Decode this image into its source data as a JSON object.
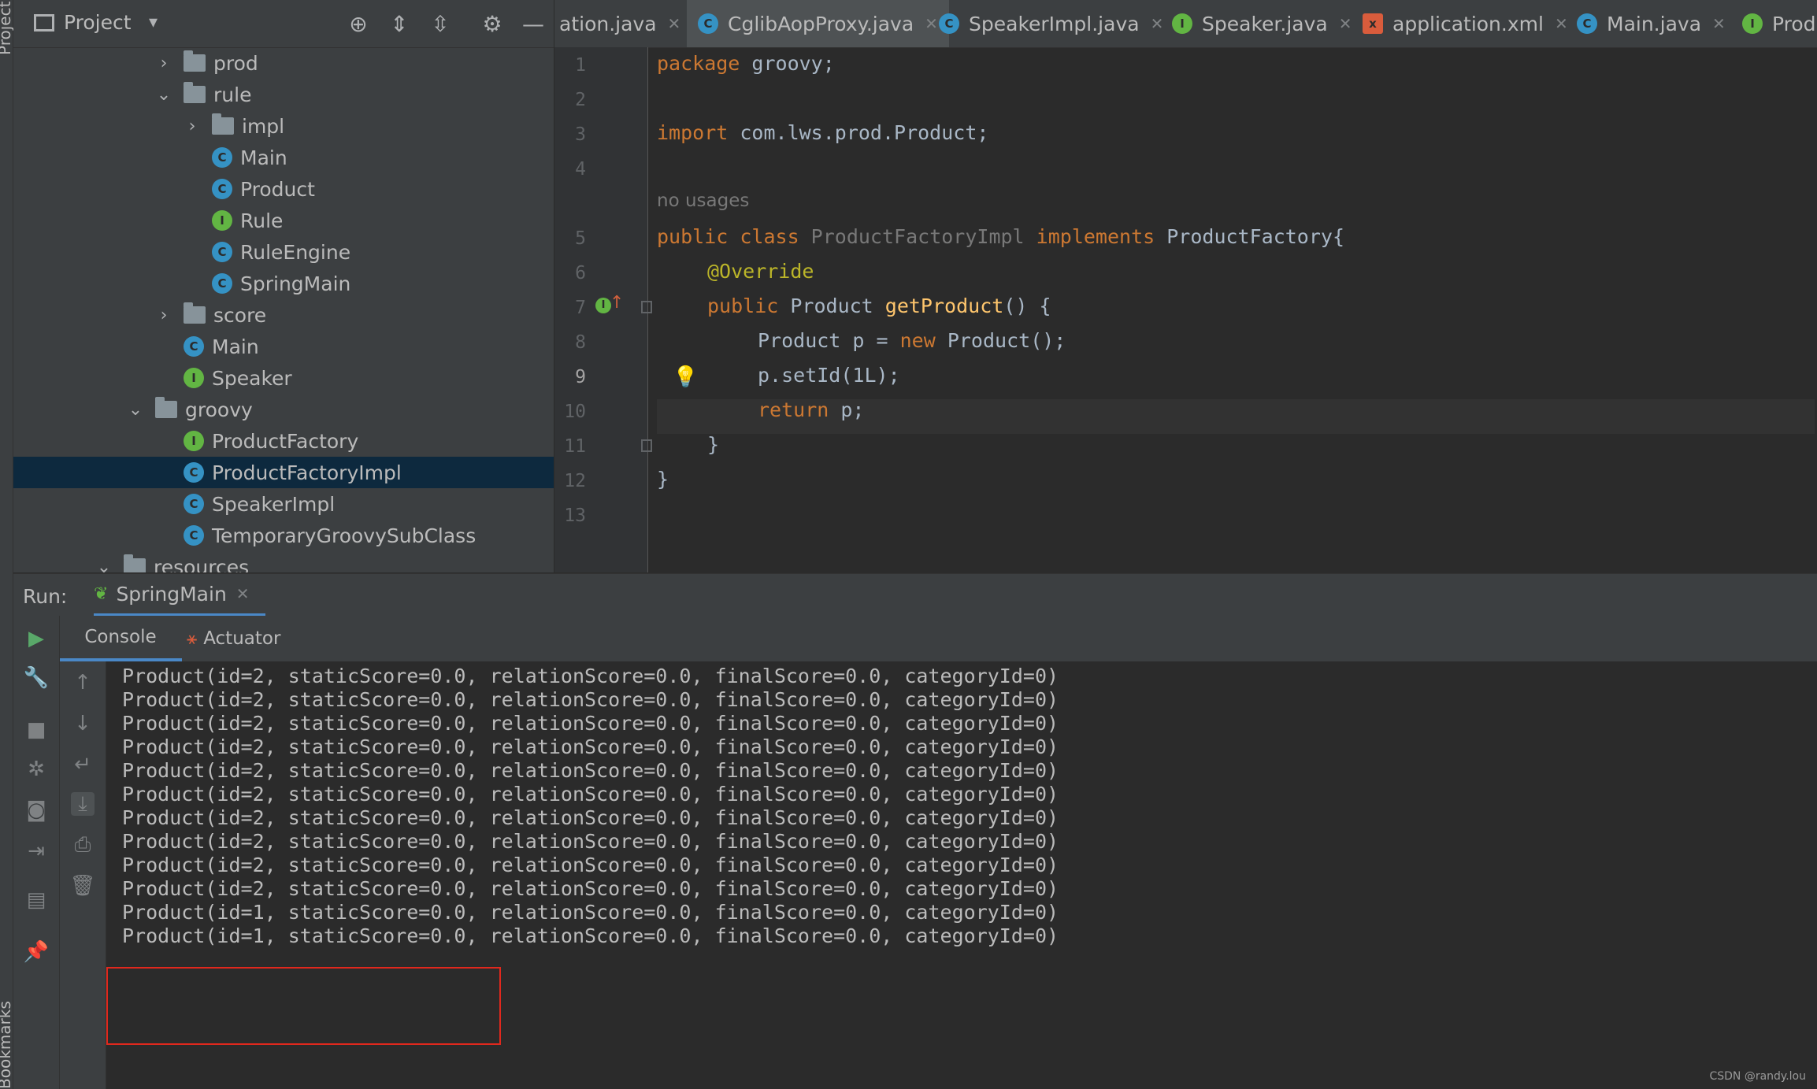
{
  "left_strip": {
    "project_label": "Project",
    "bookmarks_label": "Bookmarks"
  },
  "project_panel": {
    "title": "Project",
    "tree": [
      {
        "label": "prod",
        "type": "folder",
        "expand": "collapsed"
      },
      {
        "label": "rule",
        "type": "folder",
        "expand": "expanded"
      },
      {
        "label": "impl",
        "type": "package",
        "expand": "collapsed"
      },
      {
        "label": "Main",
        "type": "class"
      },
      {
        "label": "Product",
        "type": "class"
      },
      {
        "label": "Rule",
        "type": "interface"
      },
      {
        "label": "RuleEngine",
        "type": "class"
      },
      {
        "label": "SpringMain",
        "type": "class"
      },
      {
        "label": "score",
        "type": "folder",
        "expand": "collapsed"
      },
      {
        "label": "Main",
        "type": "class"
      },
      {
        "label": "Speaker",
        "type": "interface"
      },
      {
        "label": "groovy",
        "type": "folder",
        "expand": "expanded"
      },
      {
        "label": "ProductFactory",
        "type": "interface"
      },
      {
        "label": "ProductFactoryImpl",
        "type": "class",
        "selected": true
      },
      {
        "label": "SpeakerImpl",
        "type": "class"
      },
      {
        "label": "TemporaryGroovySubClass",
        "type": "class"
      },
      {
        "label": "resources",
        "type": "folder",
        "expand": "expanded"
      }
    ]
  },
  "editor": {
    "tabs": [
      {
        "label": "ation.java",
        "icon": "none"
      },
      {
        "label": "CglibAopProxy.java",
        "icon": "class"
      },
      {
        "label": "SpeakerImpl.java",
        "icon": "class"
      },
      {
        "label": "Speaker.java",
        "icon": "interface"
      },
      {
        "label": "application.xml",
        "icon": "xml"
      },
      {
        "label": "Main.java",
        "icon": "class"
      },
      {
        "label": "Prod",
        "icon": "interface"
      }
    ],
    "line_numbers": [
      "1",
      "2",
      "3",
      "4",
      "5",
      "6",
      "7",
      "8",
      "9",
      "10",
      "11",
      "12",
      "13"
    ],
    "usage_hint": "no usages",
    "code": {
      "l1_kw": "package",
      "l1_rest": " groovy;",
      "l3_kw": "import",
      "l3_rest": " com.lws.prod.Product;",
      "l5_kw1": "public",
      "l5_kw2": " class",
      "l5_name": " ProductFactoryImpl",
      "l5_kw3": " implements",
      "l5_rest": " ProductFactory{",
      "l6_ann": "@Override",
      "l7_kw": "public",
      "l7_type": " Product ",
      "l7_fn": "getProduct",
      "l7_rest": "() {",
      "l8_a": "Product p = ",
      "l8_kw": "new",
      "l8_b": " Product();",
      "l9": "p.setId(1L);",
      "l10_kw": "return",
      "l10_rest": " p;",
      "l11": "}",
      "l12": "}"
    }
  },
  "run": {
    "label": "Run:",
    "config": "SpringMain",
    "tabs": {
      "console": "Console",
      "actuator": "Actuator"
    },
    "output": [
      "Product(id=2, staticScore=0.0, relationScore=0.0, finalScore=0.0, categoryId=0)",
      "Product(id=2, staticScore=0.0, relationScore=0.0, finalScore=0.0, categoryId=0)",
      "Product(id=2, staticScore=0.0, relationScore=0.0, finalScore=0.0, categoryId=0)",
      "Product(id=2, staticScore=0.0, relationScore=0.0, finalScore=0.0, categoryId=0)",
      "Product(id=2, staticScore=0.0, relationScore=0.0, finalScore=0.0, categoryId=0)",
      "Product(id=2, staticScore=0.0, relationScore=0.0, finalScore=0.0, categoryId=0)",
      "Product(id=2, staticScore=0.0, relationScore=0.0, finalScore=0.0, categoryId=0)",
      "Product(id=2, staticScore=0.0, relationScore=0.0, finalScore=0.0, categoryId=0)",
      "Product(id=2, staticScore=0.0, relationScore=0.0, finalScore=0.0, categoryId=0)",
      "Product(id=2, staticScore=0.0, relationScore=0.0, finalScore=0.0, categoryId=0)",
      "Product(id=1, staticScore=0.0, relationScore=0.0, finalScore=0.0, categoryId=0)",
      "Product(id=1, staticScore=0.0, relationScore=0.0, finalScore=0.0, categoryId=0)"
    ]
  },
  "watermark": "CSDN @randy.lou",
  "colors": {
    "highlight_box": "#e0281d",
    "selection": "#0d293e",
    "class_icon": "#3592c4",
    "interface_icon": "#62b543"
  }
}
